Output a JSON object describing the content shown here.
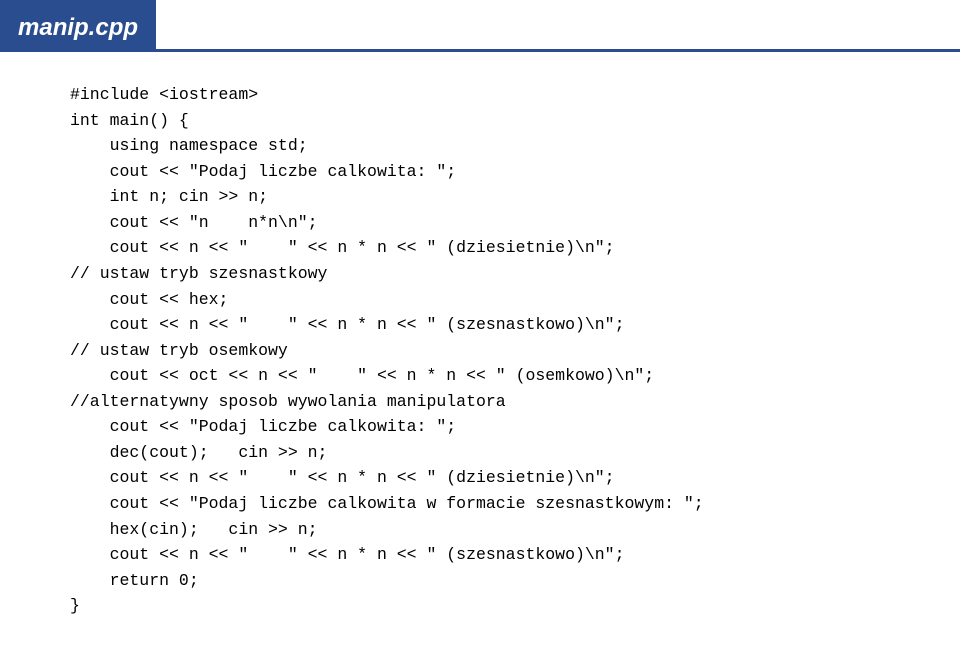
{
  "header": {
    "title": "manip.cpp"
  },
  "code": {
    "l1": "#include <iostream>",
    "l2": "int main() {",
    "l3": "    using namespace std;",
    "l4": "    cout << \"Podaj liczbe calkowita: \";",
    "l5": "    int n; cin >> n;",
    "l6": "    cout << \"n    n*n\\n\";",
    "l7": "    cout << n << \"    \" << n * n << \" (dziesietnie)\\n\";",
    "l8": "// ustaw tryb szesnastkowy",
    "l9": "    cout << hex;",
    "l10": "    cout << n << \"    \" << n * n << \" (szesnastkowo)\\n\";",
    "l11": "// ustaw tryb osemkowy",
    "l12": "    cout << oct << n << \"    \" << n * n << \" (osemkowo)\\n\";",
    "l13": "//alternatywny sposob wywolania manipulatora",
    "l14": "    cout << \"Podaj liczbe calkowita: \";",
    "l15": "    dec(cout);   cin >> n;",
    "l16": "    cout << n << \"    \" << n * n << \" (dziesietnie)\\n\";",
    "l17": "    cout << \"Podaj liczbe calkowita w formacie szesnastkowym: \";",
    "l18": "    hex(cin);   cin >> n;",
    "l19": "    cout << n << \"    \" << n * n << \" (szesnastkowo)\\n\";",
    "l20": "    return 0;",
    "l21": "}"
  }
}
